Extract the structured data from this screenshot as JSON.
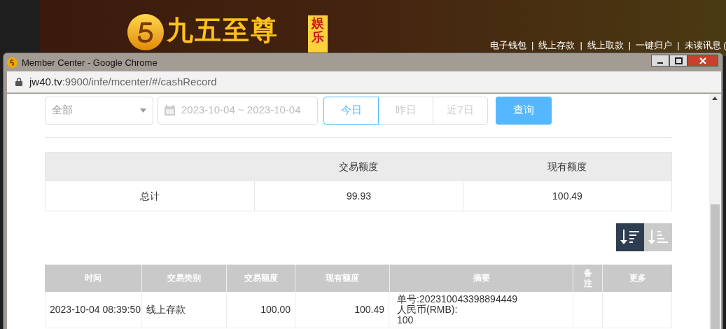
{
  "banner": {
    "logo_text": "九五至尊",
    "badge_text": "娱乐",
    "nav_links": [
      {
        "kind": "link",
        "label": "电子钱包"
      },
      {
        "kind": "separator",
        "label": "|"
      },
      {
        "kind": "link",
        "label": "线上存款"
      },
      {
        "kind": "separator",
        "label": "|"
      },
      {
        "kind": "link",
        "label": "线上取款"
      },
      {
        "kind": "separator",
        "label": "|"
      },
      {
        "kind": "link",
        "label": "一键归户"
      },
      {
        "kind": "separator",
        "label": "|"
      },
      {
        "kind": "link",
        "label": "未读讯息 ("
      }
    ]
  },
  "window": {
    "title": "Member Center - Google Chrome"
  },
  "address_bar": {
    "host": "jw40.tv",
    "path": ":9900/infe/mcenter/#/cashRecord"
  },
  "filters": {
    "type_select": {
      "value": "全部"
    },
    "date_range": {
      "value": "2023-10-04 ~ 2023-10-04"
    },
    "quick_ranges": [
      {
        "label": "今日",
        "selected": true
      },
      {
        "label": "昨日",
        "selected": false
      },
      {
        "label": "近7日",
        "selected": false
      }
    ],
    "query_button": "查询"
  },
  "summary_table": {
    "columns": [
      "交易额度",
      "现有额度"
    ],
    "rows": [
      {
        "label": "总计",
        "cells": [
          "99.93",
          "100.49"
        ]
      }
    ]
  },
  "sort_buttons": [
    {
      "kind": "desc",
      "selected": true
    },
    {
      "kind": "asc",
      "selected": false
    }
  ],
  "records_table": {
    "columns": [
      "时间",
      "交易类别",
      "交易额度",
      "现有额度",
      "摘要",
      "备注",
      "更多"
    ],
    "rows": [
      {
        "time": "2023-10-04 08:39:50",
        "type": "线上存款",
        "amount": "100.00",
        "balance": "100.49",
        "summary": [
          "单号:202310043398894449",
          "人民币(RMB):",
          "100"
        ]
      }
    ]
  }
}
